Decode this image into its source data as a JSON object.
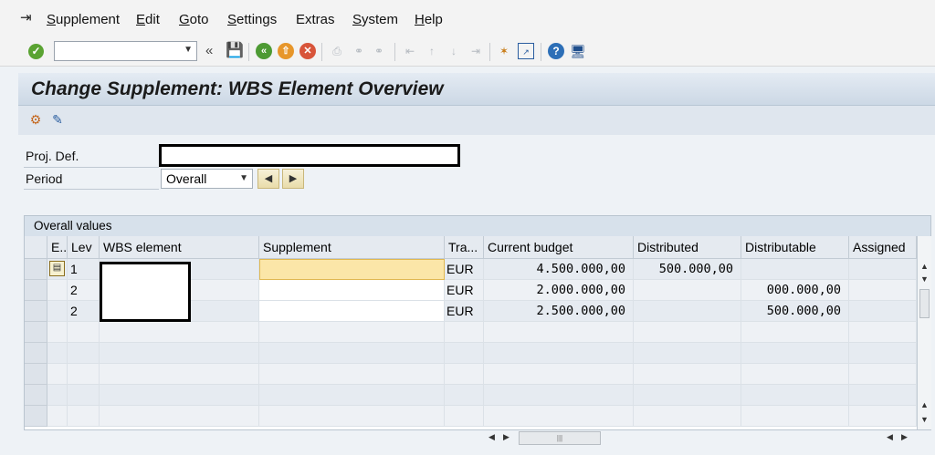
{
  "menu": {
    "items": [
      {
        "label": "Supplement",
        "u": "S",
        "rest": "upplement"
      },
      {
        "label": "Edit",
        "u": "E",
        "rest": "dit"
      },
      {
        "label": "Goto",
        "u": "G",
        "rest": "oto"
      },
      {
        "label": "Settings",
        "u": "S",
        "rest": "ettings"
      },
      {
        "label": "Extras",
        "u": "",
        "rest": "Extras"
      },
      {
        "label": "System",
        "u": "S",
        "rest": "ystem"
      },
      {
        "label": "Help",
        "u": "H",
        "rest": "elp"
      }
    ]
  },
  "toolbar": {
    "command_field_value": "",
    "icons": [
      "enter-icon",
      "save-icon",
      "back-icon",
      "exit-icon",
      "cancel-icon",
      "print-icon",
      "find-icon",
      "find-next-icon",
      "first-page-icon",
      "previous-page-icon",
      "next-page-icon",
      "last-page-icon",
      "create-session-icon",
      "generate-shortcut-icon",
      "help-icon",
      "customize-layout-icon"
    ]
  },
  "title": "Change Supplement: WBS Element Overview",
  "fields": {
    "proj_def_label": "Proj. Def.",
    "proj_def_value": "",
    "period_label": "Period",
    "period_value": "Overall"
  },
  "table": {
    "title": "Overall values",
    "columns": [
      "E...",
      "Lev",
      "WBS element",
      "Supplement",
      "Tra...",
      "Current budget",
      "Distributed",
      "Distributable",
      "Assigned"
    ],
    "rows": [
      {
        "lev": "1",
        "wbs": "",
        "supplement": "",
        "currency": "EUR",
        "current_budget": "4.500.000,00",
        "distributed": "500.000,00",
        "distributable": "",
        "assigned": ""
      },
      {
        "lev": "2",
        "wbs": "",
        "supplement": "",
        "currency": "EUR",
        "current_budget": "2.000.000,00",
        "distributed": "",
        "distributable": "000.000,00",
        "assigned": ""
      },
      {
        "lev": "2",
        "wbs": "",
        "supplement": "",
        "currency": "EUR",
        "current_budget": "2.500.000,00",
        "distributed": "",
        "distributable": "500.000,00",
        "assigned": ""
      }
    ],
    "empty_rows": 5
  },
  "colors": {
    "title_bg": "#d4dfea",
    "input_highlight": "#fbe6a8",
    "ok_green": "#5aa332"
  }
}
